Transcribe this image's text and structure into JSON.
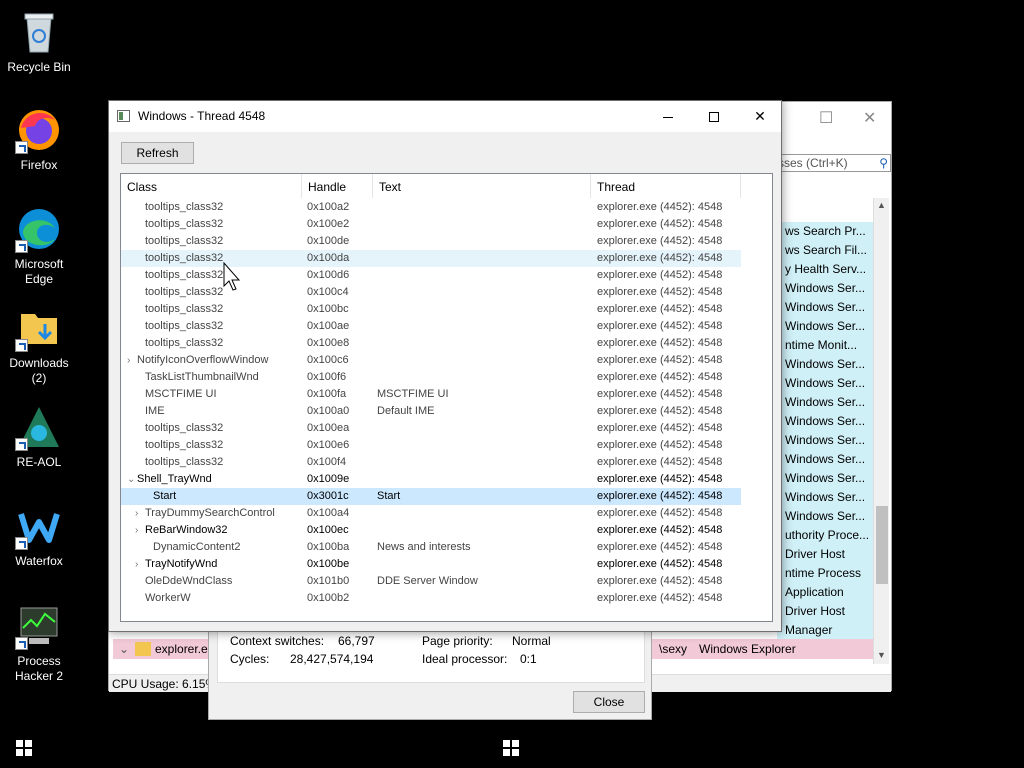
{
  "desktop": {
    "icons": [
      {
        "label": "Recycle Bin"
      },
      {
        "label": "Firefox"
      },
      {
        "label": "Microsoft Edge"
      },
      {
        "label": "Downloads (2)"
      },
      {
        "label": "RE-AOL"
      },
      {
        "label": "Waterfox"
      },
      {
        "label": "Process Hacker 2"
      }
    ]
  },
  "background_window": {
    "search_placeholder": "sses (Ctrl+K)",
    "list": [
      "ws Search Pr...",
      "ws Search Fil...",
      "y Health Serv...",
      "Windows Ser...",
      "Windows Ser...",
      "Windows Ser...",
      "ntime Monit...",
      "Windows Ser...",
      "Windows Ser...",
      "Windows Ser...",
      "Windows Ser...",
      "Windows Ser...",
      "Windows Ser...",
      "Windows Ser...",
      "Windows Ser...",
      "Windows Ser...",
      "uthority Proce...",
      "Driver Host",
      "ntime Process",
      "Application",
      "Driver Host",
      "Manager"
    ],
    "explorer_row": {
      "name": "explorer.e",
      "path": "\\sexy",
      "desc": "Windows Explorer"
    },
    "status": "CPU Usage: 6.15%"
  },
  "thread_props": {
    "context_switches_label": "Context switches:",
    "context_switches_value": "66,797",
    "page_priority_label": "Page priority:",
    "page_priority_value": "Normal",
    "cycles_label": "Cycles:",
    "cycles_value": "28,427,574,194",
    "ideal_processor_label": "Ideal processor:",
    "ideal_processor_value": "0:1",
    "close_label": "Close"
  },
  "dialog": {
    "title": "Windows - Thread 4548",
    "refresh_label": "Refresh",
    "columns": {
      "class": "Class",
      "handle": "Handle",
      "text": "Text",
      "thread": "Thread"
    },
    "rows": [
      {
        "cls": "tooltips_class32",
        "handle": "0x100a2",
        "text": "",
        "thread": "explorer.exe (4452): 4548",
        "indent": 1,
        "chev": "",
        "state": "",
        "bold": false
      },
      {
        "cls": "tooltips_class32",
        "handle": "0x100e2",
        "text": "",
        "thread": "explorer.exe (4452): 4548",
        "indent": 1,
        "chev": "",
        "state": "",
        "bold": false
      },
      {
        "cls": "tooltips_class32",
        "handle": "0x100de",
        "text": "",
        "thread": "explorer.exe (4452): 4548",
        "indent": 1,
        "chev": "",
        "state": "",
        "bold": false
      },
      {
        "cls": "tooltips_class32",
        "handle": "0x100da",
        "text": "",
        "thread": "explorer.exe (4452): 4548",
        "indent": 1,
        "chev": "",
        "state": "hover",
        "bold": false
      },
      {
        "cls": "tooltips_class32",
        "handle": "0x100d6",
        "text": "",
        "thread": "explorer.exe (4452): 4548",
        "indent": 1,
        "chev": "",
        "state": "",
        "bold": false
      },
      {
        "cls": "tooltips_class32",
        "handle": "0x100c4",
        "text": "",
        "thread": "explorer.exe (4452): 4548",
        "indent": 1,
        "chev": "",
        "state": "",
        "bold": false
      },
      {
        "cls": "tooltips_class32",
        "handle": "0x100bc",
        "text": "",
        "thread": "explorer.exe (4452): 4548",
        "indent": 1,
        "chev": "",
        "state": "",
        "bold": false
      },
      {
        "cls": "tooltips_class32",
        "handle": "0x100ae",
        "text": "",
        "thread": "explorer.exe (4452): 4548",
        "indent": 1,
        "chev": "",
        "state": "",
        "bold": false
      },
      {
        "cls": "tooltips_class32",
        "handle": "0x100e8",
        "text": "",
        "thread": "explorer.exe (4452): 4548",
        "indent": 1,
        "chev": "",
        "state": "",
        "bold": false
      },
      {
        "cls": "NotifyIconOverflowWindow",
        "handle": "0x100c6",
        "text": "",
        "thread": "explorer.exe (4452): 4548",
        "indent": 0,
        "chev": "›",
        "state": "",
        "bold": false
      },
      {
        "cls": "TaskListThumbnailWnd",
        "handle": "0x100f6",
        "text": "",
        "thread": "explorer.exe (4452): 4548",
        "indent": 1,
        "chev": "",
        "state": "",
        "bold": false
      },
      {
        "cls": "MSCTFIME UI",
        "handle": "0x100fa",
        "text": "MSCTFIME UI",
        "thread": "explorer.exe (4452): 4548",
        "indent": 1,
        "chev": "",
        "state": "",
        "bold": false
      },
      {
        "cls": "IME",
        "handle": "0x100a0",
        "text": "Default IME",
        "thread": "explorer.exe (4452): 4548",
        "indent": 1,
        "chev": "",
        "state": "",
        "bold": false
      },
      {
        "cls": "tooltips_class32",
        "handle": "0x100ea",
        "text": "",
        "thread": "explorer.exe (4452): 4548",
        "indent": 1,
        "chev": "",
        "state": "",
        "bold": false
      },
      {
        "cls": "tooltips_class32",
        "handle": "0x100e6",
        "text": "",
        "thread": "explorer.exe (4452): 4548",
        "indent": 1,
        "chev": "",
        "state": "",
        "bold": false
      },
      {
        "cls": "tooltips_class32",
        "handle": "0x100f4",
        "text": "",
        "thread": "explorer.exe (4452): 4548",
        "indent": 1,
        "chev": "",
        "state": "",
        "bold": false
      },
      {
        "cls": "Shell_TrayWnd",
        "handle": "0x1009e",
        "text": "",
        "thread": "explorer.exe (4452): 4548",
        "indent": 0,
        "chev": "⌄",
        "state": "",
        "bold": true
      },
      {
        "cls": "Start",
        "handle": "0x3001c",
        "text": "Start",
        "thread": "explorer.exe (4452): 4548",
        "indent": 2,
        "chev": "",
        "state": "selected",
        "bold": true
      },
      {
        "cls": "TrayDummySearchControl",
        "handle": "0x100a4",
        "text": "",
        "thread": "explorer.exe (4452): 4548",
        "indent": 1,
        "chev": "›",
        "state": "",
        "bold": false
      },
      {
        "cls": "ReBarWindow32",
        "handle": "0x100ec",
        "text": "",
        "thread": "explorer.exe (4452): 4548",
        "indent": 1,
        "chev": "›",
        "state": "",
        "bold": true
      },
      {
        "cls": "DynamicContent2",
        "handle": "0x100ba",
        "text": "News and interests",
        "thread": "explorer.exe (4452): 4548",
        "indent": 2,
        "chev": "",
        "state": "",
        "bold": false
      },
      {
        "cls": "TrayNotifyWnd",
        "handle": "0x100be",
        "text": "",
        "thread": "explorer.exe (4452): 4548",
        "indent": 1,
        "chev": "›",
        "state": "",
        "bold": true
      },
      {
        "cls": "OleDdeWndClass",
        "handle": "0x101b0",
        "text": "DDE Server Window",
        "thread": "explorer.exe (4452): 4548",
        "indent": 1,
        "chev": "",
        "state": "",
        "bold": false
      },
      {
        "cls": "WorkerW",
        "handle": "0x100b2",
        "text": "",
        "thread": "explorer.exe (4452): 4548",
        "indent": 1,
        "chev": "",
        "state": "",
        "bold": false
      }
    ]
  }
}
